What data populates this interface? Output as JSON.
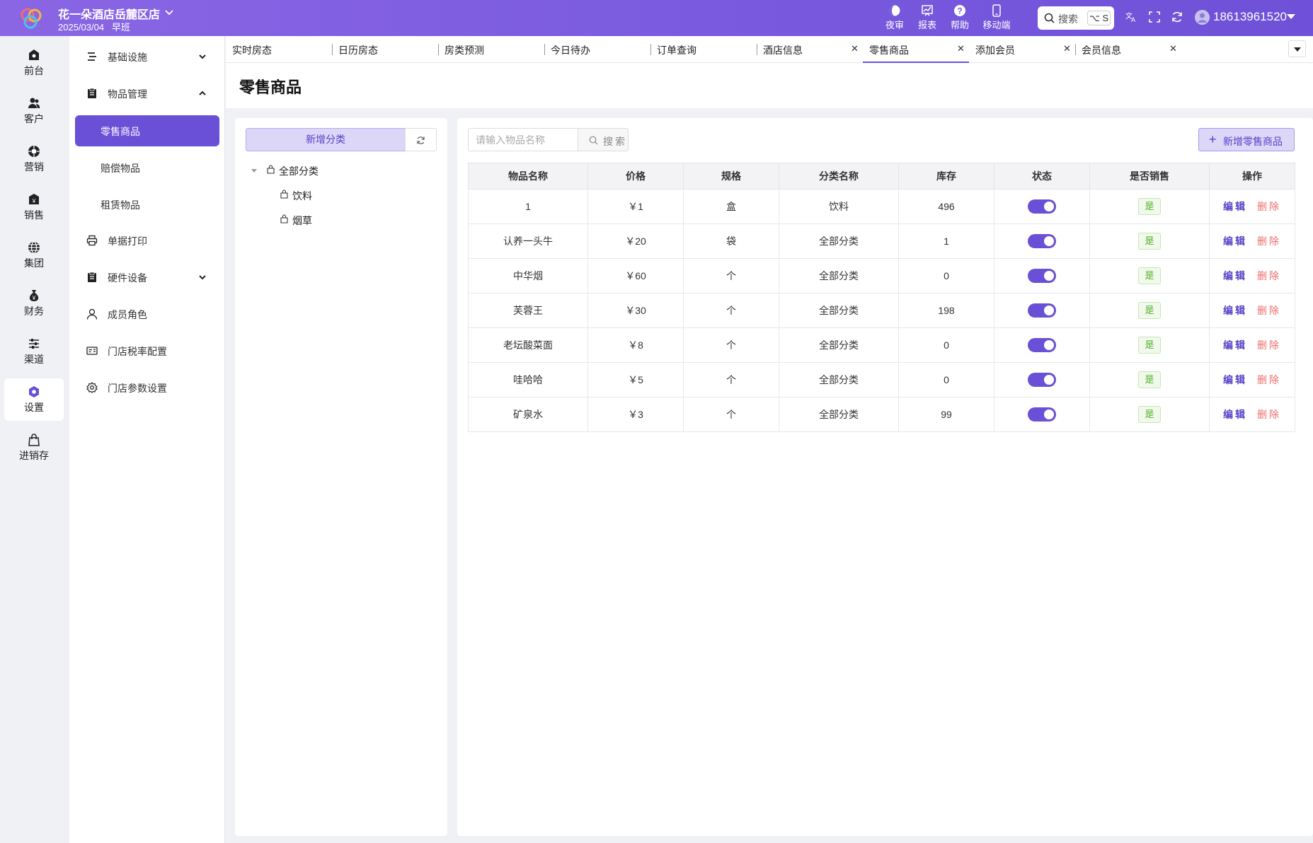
{
  "header": {
    "store_name": "花一朵酒店岳麓区店",
    "date_shift": "2025/03/04   早班",
    "tools": [
      {
        "label": "夜审",
        "icon": "night-audit-icon"
      },
      {
        "label": "报表",
        "icon": "report-icon"
      },
      {
        "label": "帮助",
        "icon": "help-icon"
      },
      {
        "label": "移动端",
        "icon": "mobile-icon"
      }
    ],
    "search_label": "搜索",
    "search_shortcut": "⌥ S",
    "account": "18613961520"
  },
  "rail": [
    {
      "label": "前台",
      "icon": "front-desk-icon"
    },
    {
      "label": "客户",
      "icon": "customers-icon"
    },
    {
      "label": "营销",
      "icon": "marketing-icon"
    },
    {
      "label": "销售",
      "icon": "sales-icon"
    },
    {
      "label": "集团",
      "icon": "group-icon"
    },
    {
      "label": "财务",
      "icon": "finance-icon"
    },
    {
      "label": "渠道",
      "icon": "channel-icon"
    },
    {
      "label": "设置",
      "icon": "settings-icon",
      "active": true
    },
    {
      "label": "进销存",
      "icon": "inventory-icon"
    }
  ],
  "menu": {
    "basic": "基础设施",
    "goods_mgmt": "物品管理",
    "retail": "零售商品",
    "compensation": "赔偿物品",
    "rental": "租赁物品",
    "print": "单据打印",
    "hardware": "硬件设备",
    "roles": "成员角色",
    "tax": "门店税率配置",
    "params": "门店参数设置"
  },
  "tabs": [
    {
      "label": "实时房态",
      "closable": false
    },
    {
      "label": "日历房态",
      "closable": false
    },
    {
      "label": "房类预测",
      "closable": false
    },
    {
      "label": "今日待办",
      "closable": false
    },
    {
      "label": "订单查询",
      "closable": false
    },
    {
      "label": "酒店信息",
      "closable": true
    },
    {
      "label": "零售商品",
      "closable": true,
      "active": true
    },
    {
      "label": "添加会员",
      "closable": true
    },
    {
      "label": "会员信息",
      "closable": true
    }
  ],
  "page_title": "零售商品",
  "categories": {
    "add_label": "新增分类",
    "tree": [
      "全部分类",
      "饮料",
      "烟草"
    ]
  },
  "goods": {
    "search_placeholder": "请输入物品名称",
    "search_button": "搜索",
    "new_button": "新增零售商品",
    "columns": [
      "物品名称",
      "价格",
      "规格",
      "分类名称",
      "库存",
      "状态",
      "是否销售",
      "操作"
    ],
    "rows": [
      {
        "name": "1",
        "price": "￥1",
        "spec": "盒",
        "category": "饮料",
        "stock": "496",
        "enabled": true,
        "on_sale": "是"
      },
      {
        "name": "认养一头牛",
        "price": "￥20",
        "spec": "袋",
        "category": "全部分类",
        "stock": "1",
        "enabled": true,
        "on_sale": "是"
      },
      {
        "name": "中华烟",
        "price": "￥60",
        "spec": "个",
        "category": "全部分类",
        "stock": "0",
        "enabled": true,
        "on_sale": "是"
      },
      {
        "name": "芙蓉王",
        "price": "￥30",
        "spec": "个",
        "category": "全部分类",
        "stock": "198",
        "enabled": true,
        "on_sale": "是"
      },
      {
        "name": "老坛酸菜面",
        "price": "￥8",
        "spec": "个",
        "category": "全部分类",
        "stock": "0",
        "enabled": true,
        "on_sale": "是"
      },
      {
        "name": "哇哈哈",
        "price": "￥5",
        "spec": "个",
        "category": "全部分类",
        "stock": "0",
        "enabled": true,
        "on_sale": "是"
      },
      {
        "name": "矿泉水",
        "price": "￥3",
        "spec": "个",
        "category": "全部分类",
        "stock": "99",
        "enabled": true,
        "on_sale": "是"
      }
    ],
    "edit_label": "编辑",
    "delete_label": "删除"
  },
  "colors": {
    "accent": "#6a50d6",
    "header_start": "#8a66e4",
    "header_end": "#6e51d8",
    "sale_green": "#52b026",
    "delete_red": "#ee6b6b"
  }
}
